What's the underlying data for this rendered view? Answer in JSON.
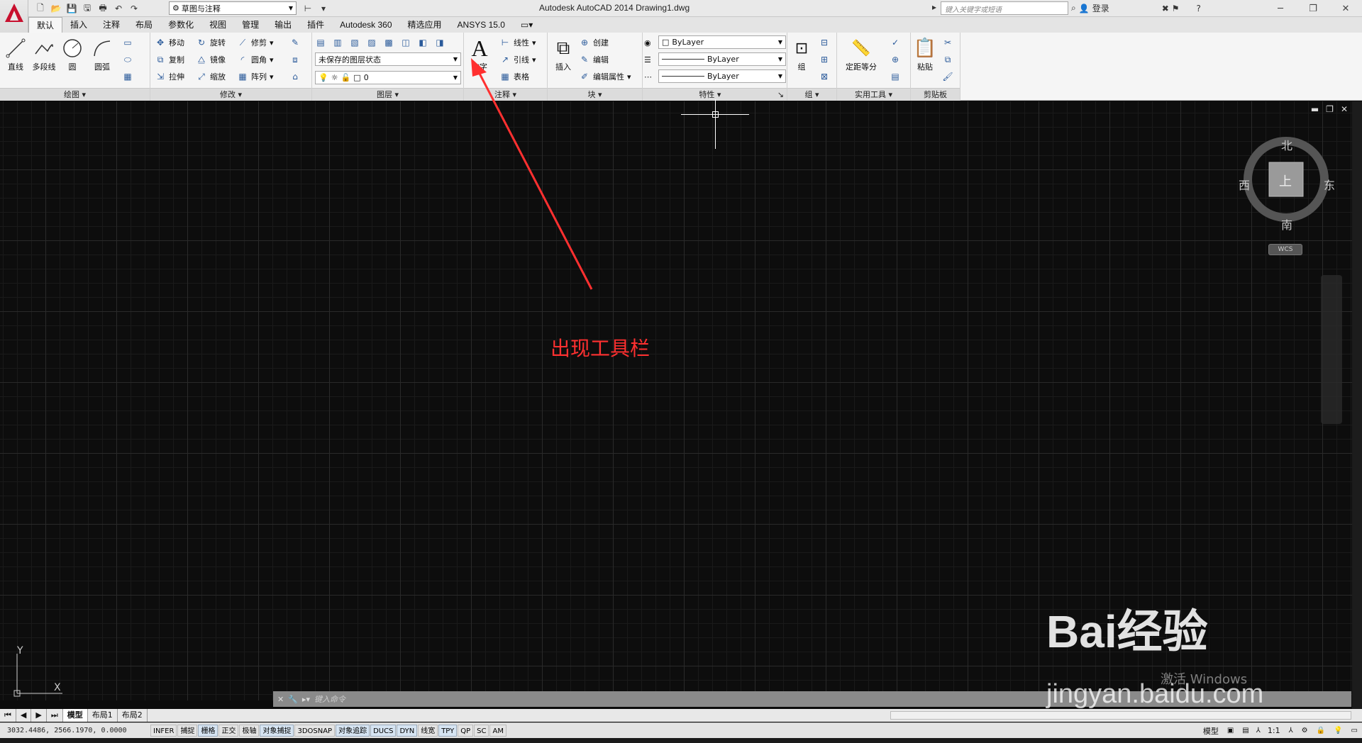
{
  "titlebar": {
    "app_title": "Autodesk AutoCAD 2014    Drawing1.dwg",
    "workspace": "草图与注释",
    "search_placeholder": "键入关键字或短语",
    "login": "登录"
  },
  "menu_tabs": [
    "默认",
    "插入",
    "注释",
    "布局",
    "参数化",
    "视图",
    "管理",
    "输出",
    "插件",
    "Autodesk 360",
    "精选应用",
    "ANSYS 15.0"
  ],
  "ribbon": {
    "draw": {
      "label": "绘图",
      "line": "直线",
      "polyline": "多段线",
      "circle": "圆",
      "arc": "圆弧"
    },
    "modify": {
      "label": "修改",
      "move": "移动",
      "rotate": "旋转",
      "trim": "修剪",
      "copy": "复制",
      "mirror": "镜像",
      "fillet": "圆角",
      "stretch": "拉伸",
      "scale": "缩放",
      "array": "阵列"
    },
    "layers": {
      "label": "图层",
      "state": "未保存的图层状态",
      "current": "0"
    },
    "annotation": {
      "label": "注释",
      "text": "文字",
      "dimension": "线性",
      "leader": "引线",
      "table": "表格"
    },
    "block": {
      "label": "块",
      "insert": "插入",
      "create": "创建",
      "edit": "编辑",
      "edit_attr": "编辑属性"
    },
    "properties": {
      "label": "特性",
      "color": "ByLayer",
      "linetype": "ByLayer",
      "lineweight": "ByLayer"
    },
    "groups": {
      "label": "组",
      "group": "组"
    },
    "utilities": {
      "label": "实用工具",
      "measure": "定距等分"
    },
    "clipboard": {
      "label": "剪贴板",
      "paste": "粘贴"
    }
  },
  "viewcube": {
    "north": "北",
    "south": "南",
    "east": "东",
    "west": "西",
    "top": "上",
    "wcs": "WCS"
  },
  "annotation_text": "出现工具栏",
  "ucs": {
    "y": "Y",
    "x": "X"
  },
  "command": {
    "placeholder": "键入命令"
  },
  "layout_tabs": [
    "模型",
    "布局1",
    "布局2"
  ],
  "status": {
    "coords": "3032.4486, 2566.1970, 0.0000",
    "toggles": [
      "INFER",
      "捕捉",
      "栅格",
      "正交",
      "极轴",
      "对象捕捉",
      "3DOSNAP",
      "对象追踪",
      "DUCS",
      "DYN",
      "线宽",
      "TPY",
      "QP",
      "SC",
      "AM"
    ],
    "model": "模型",
    "scale": "1:1"
  },
  "watermark": {
    "brand": "Bai经验",
    "site": "jingyan.baidu.com",
    "activate": "激活 Windows"
  },
  "colors": {
    "annotation": "#ff3030",
    "canvas": "#0d0d0d",
    "ribbon": "#f5f5f5"
  }
}
